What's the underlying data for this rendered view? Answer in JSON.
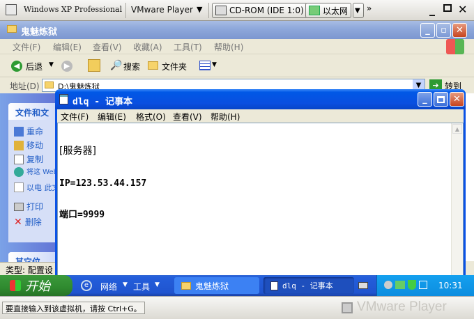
{
  "vmware": {
    "os_name": "Windows XP Professional",
    "player_menu": "VMware Player",
    "cdrom": "CD-ROM (IDE 1:0)",
    "network": "以太网",
    "status_message": "要直接输入到该虚拟机，请按 Ctrl+G。",
    "brand": "VMware Player"
  },
  "explorer": {
    "title": "鬼魅炼狱",
    "menu": [
      "文件(F)",
      "编辑(E)",
      "查看(V)",
      "收藏(A)",
      "工具(T)",
      "帮助(H)"
    ],
    "toolbar": {
      "back": "后退",
      "search": "搜索",
      "folders": "文件夹"
    },
    "address_label": "地址(D)",
    "address_value": "D:\\鬼魅炼狱",
    "go_label": "转到",
    "taskpane": {
      "header": "文件和文",
      "items": [
        "重命",
        "移动",
        "复制",
        "将这 Web",
        "以电 此文",
        "打印",
        "删除"
      ],
      "other_header": "其它位"
    },
    "status_label": "类型: 配置设"
  },
  "notepad": {
    "title": "dlq - 记事本",
    "menu": [
      "文件(F)",
      "编辑(E)",
      "格式(O)",
      "查看(V)",
      "帮助(H)"
    ],
    "lines": [
      "[服务器]",
      "IP=123.53.44.157",
      "端口=9999"
    ]
  },
  "taskbar": {
    "start": "开始",
    "network": "网络",
    "tools": "工具",
    "task_explorer": "鬼魅炼狱",
    "task_notepad": "dlq - 记事本",
    "clock": "10:31"
  }
}
